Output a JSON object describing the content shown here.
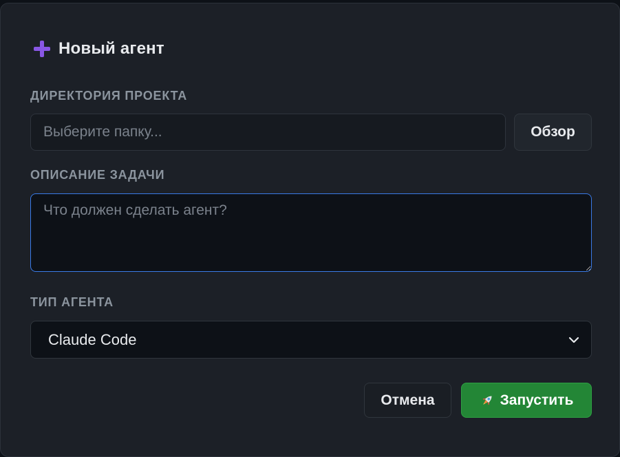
{
  "dialog": {
    "title": "Новый агент",
    "accent_color": "#8957e5"
  },
  "project_dir": {
    "label": "ДИРЕКТОРИЯ ПРОЕКТА",
    "placeholder": "Выберите папку...",
    "value": "",
    "browse_label": "Обзор"
  },
  "task": {
    "label": "ОПИСАНИЕ ЗАДАЧИ",
    "placeholder": "Что должен сделать агент?",
    "value": ""
  },
  "agent_type": {
    "label": "ТИП АГЕНТА",
    "selected": "Claude Code"
  },
  "actions": {
    "cancel_label": "Отмена",
    "launch_label": "Запустить",
    "launch_color": "#238636"
  }
}
